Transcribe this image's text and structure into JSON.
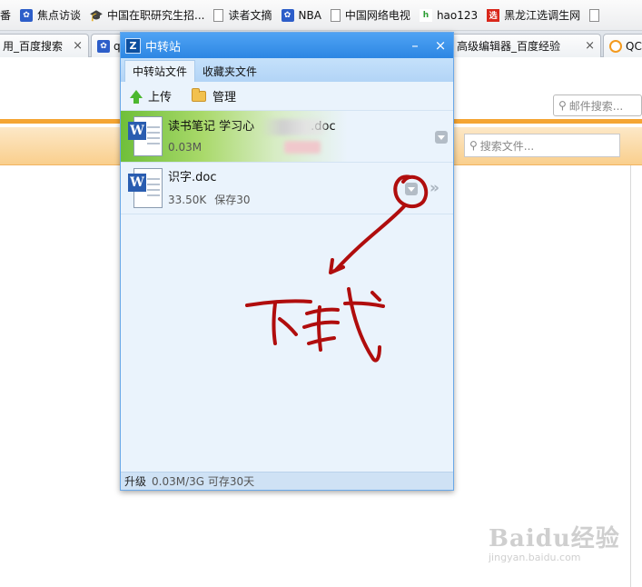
{
  "bookmarks": [
    {
      "label": "番",
      "icon": "none"
    },
    {
      "label": "焦点访谈",
      "icon": "baidu-paw-icon"
    },
    {
      "label": "中国在职研究生招...",
      "icon": "graduation-cap-icon"
    },
    {
      "label": "读者文摘",
      "icon": "page-icon"
    },
    {
      "label": "NBA",
      "icon": "baidu-paw-icon"
    },
    {
      "label": "中国网络电视",
      "icon": "page-icon"
    },
    {
      "label": "hao123",
      "icon": "hao123-icon"
    },
    {
      "label": "黑龙江选调生网",
      "icon": "xuan-icon"
    },
    {
      "label": "",
      "icon": "page-icon"
    }
  ],
  "tabs": [
    {
      "label": "用_百度搜索",
      "close": "×"
    },
    {
      "label": "q",
      "close": ""
    },
    {
      "label": "高级编辑器_百度经验",
      "close": "×"
    },
    {
      "label": "QC",
      "close": ""
    }
  ],
  "page": {
    "mail_search_placeholder": "邮件搜索...",
    "file_search_placeholder": "搜索文件...",
    "watermark_brand": "Baidu经验",
    "watermark_site": "jingyan.baidu.com"
  },
  "window": {
    "title": "中转站",
    "logo": "Z",
    "minimize": "–",
    "close": "×",
    "tabs": [
      {
        "label": "中转站文件",
        "active": true
      },
      {
        "label": "收藏夹文件",
        "active": false
      }
    ],
    "toolbar": {
      "upload": "上传",
      "manage": "管理"
    },
    "files": [
      {
        "name_prefix": "读书笔记  学习心",
        "name_suffix": ".doc",
        "size": "0.03M",
        "keep": ""
      },
      {
        "name_prefix": "识字.doc",
        "name_suffix": "",
        "size": "33.50K",
        "keep": "保存30"
      }
    ],
    "status": {
      "upgrade": "升级",
      "usage": "0.03M/3G 可存30天"
    }
  },
  "annotation": {
    "text": "下载",
    "color": "#b00d0d"
  }
}
